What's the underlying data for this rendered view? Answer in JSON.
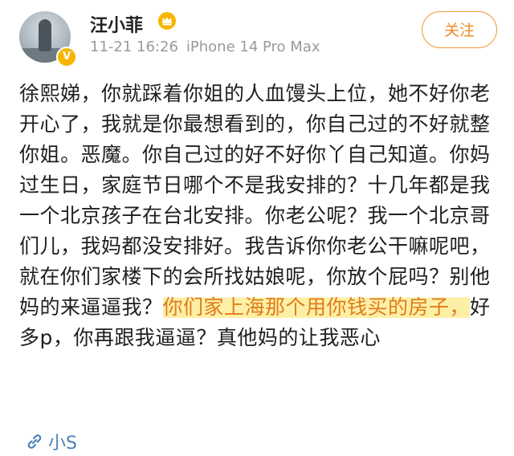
{
  "header": {
    "username": "汪小菲",
    "time": "11-21 16:26",
    "device": "iPhone 14 Pro Max",
    "follow_label": "关注",
    "verified_badge": "V"
  },
  "post": {
    "text_before": "徐熙娣，你就踩着你姐的人血馒头上位，她不好你老开心了，我就是你最想看到的，你自己过的不好就整你姐。恶魔。你自己过的好不好你丫自己知道。你妈过生日，家庭节日哪个不是我安排的？十几年都是我一个北京孩子在台北安排。你老公呢？我一个北京哥们儿，我妈都没安排好。我告诉你你老公干嘛呢吧，就在你们家楼下的会所找姑娘呢，你放个屁吗？别他妈的来逼逼我？",
    "text_highlight": "你们家上海那个用你钱买的房子，",
    "text_after": "好多p，你再跟我逼逼？真他妈的让我恶心"
  },
  "footer": {
    "link_text": "小S"
  },
  "colors": {
    "accent": "#f08a24",
    "highlight": "#fdf0a6",
    "link": "#4a7fb8",
    "meta": "#9a9a9a"
  },
  "icons": {
    "crown": "crown-icon",
    "link": "link-icon",
    "verified": "verified-badge-icon"
  }
}
